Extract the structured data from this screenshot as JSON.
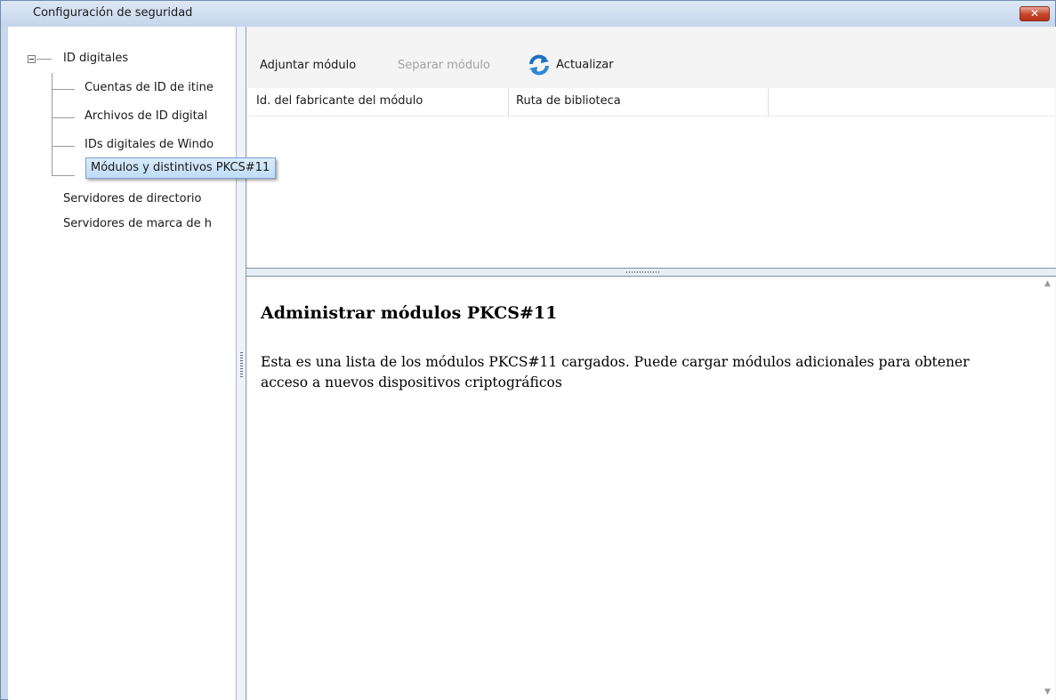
{
  "window": {
    "title": "Configuración de seguridad",
    "close_label": "✕"
  },
  "tree": {
    "root_label": "ID digitales",
    "children": [
      {
        "label": "Cuentas de ID de itine"
      },
      {
        "label": "Archivos de ID digital"
      },
      {
        "label": "IDs digitales de Windo"
      },
      {
        "label": "Módulos y distintivos PKCS#11"
      }
    ],
    "siblings": [
      {
        "label": "Servidores de directorio"
      },
      {
        "label": "Servidores de marca de h"
      }
    ],
    "selected_index": 3
  },
  "toolbar": {
    "attach_label": "Adjuntar módulo",
    "detach_label": "Separar módulo",
    "refresh_label": "Actualizar",
    "refresh_icon": "refresh-icon"
  },
  "table": {
    "columns": [
      "Id. del fabricante del módulo",
      "Ruta de biblioteca"
    ],
    "rows": []
  },
  "description": {
    "title": "Administrar módulos PKCS#11",
    "body": "Esta es una lista de los módulos PKCS#11 cargados. Puede cargar módulos adicionales para obtener acceso a nuevos dispositivos criptográficos"
  },
  "colors": {
    "title_bar": "#c9d8ec",
    "selection": "#cce4f9",
    "disabled_text": "#a2a2a2",
    "close_button": "#c6452a"
  }
}
